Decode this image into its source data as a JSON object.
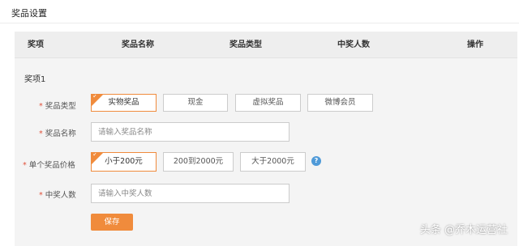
{
  "page": {
    "title": "奖品设置"
  },
  "table": {
    "headers": [
      "奖项",
      "奖品名称",
      "奖品类型",
      "中奖人数",
      "操作"
    ]
  },
  "group": {
    "title": "奖项1"
  },
  "form": {
    "required_mark": "*",
    "prize_type": {
      "label": "奖品类型",
      "options": [
        "实物奖品",
        "现金",
        "虚拟奖品",
        "微博会员"
      ],
      "selected": "实物奖品"
    },
    "prize_name": {
      "label": "奖品名称",
      "placeholder": "请输入奖品名称"
    },
    "unit_price": {
      "label": "单个奖品价格",
      "options": [
        "小于200元",
        "200到2000元",
        "大于2000元"
      ],
      "selected": "小于200元",
      "help_icon": "?"
    },
    "winners": {
      "label": "中奖人数",
      "placeholder": "请输入中奖人数"
    },
    "save_label": "保存",
    "check_glyph": "✓"
  },
  "watermark": "头条 @乔木运营社",
  "colors": {
    "accent": "#f08b3c",
    "help": "#4f9ad8",
    "required": "#e0513a"
  }
}
